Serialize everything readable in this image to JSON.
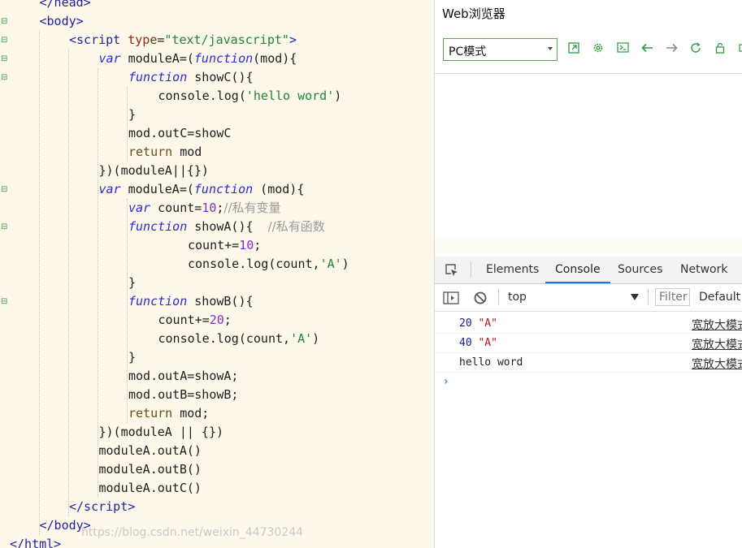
{
  "editor": {
    "lines": [
      {
        "indent": 1,
        "html": "<span class='tag'>&lt;/head&gt;</span>"
      },
      {
        "indent": 1,
        "html": "<span class='tag'>&lt;body&gt;</span>"
      },
      {
        "indent": 2,
        "html": "<span class='tag'>&lt;script</span> <span class='attr'>type</span>=<span class='str'>\"text/javascript\"</span><span class='tag'>&gt;</span>"
      },
      {
        "indent": 3,
        "html": "<span class='kw'>var</span> moduleA=(<span class='kw'>function</span>(mod){"
      },
      {
        "indent": 4,
        "html": "<span class='kw'>function</span> showC(){"
      },
      {
        "indent": 5,
        "html": "console.log(<span class='str'>'hello word'</span>)"
      },
      {
        "indent": 4,
        "html": "}"
      },
      {
        "indent": 4,
        "html": "mod.outC=showC"
      },
      {
        "indent": 4,
        "html": "<span class='plain-kw'>return</span> mod"
      },
      {
        "indent": 3,
        "html": "})(moduleA||{})"
      },
      {
        "indent": 3,
        "html": "<span class='kw'>var</span> moduleA=(<span class='kw'>function</span> (mod){"
      },
      {
        "indent": 4,
        "html": "<span class='kw'>var</span> count=<span class='num'>10</span>;<span class='cmt'>//私有变量</span>"
      },
      {
        "indent": 4,
        "html": "<span class='kw'>function</span> showA(){  <span class='cmt'>//私有函数</span>"
      },
      {
        "indent": 6,
        "html": "count+=<span class='num'>10</span>;"
      },
      {
        "indent": 6,
        "html": "console.log(count,<span class='str'>'A'</span>)"
      },
      {
        "indent": 4,
        "html": "}"
      },
      {
        "indent": 4,
        "html": "<span class='kw'>function</span> showB(){"
      },
      {
        "indent": 5,
        "html": "count+=<span class='num'>20</span>;"
      },
      {
        "indent": 5,
        "html": "console.log(count,<span class='str'>'A'</span>)"
      },
      {
        "indent": 4,
        "html": "}"
      },
      {
        "indent": 4,
        "html": "mod.outA=showA;"
      },
      {
        "indent": 4,
        "html": "mod.outB=showB;"
      },
      {
        "indent": 4,
        "html": "<span class='plain-kw'>return</span> mod;"
      },
      {
        "indent": 3,
        "html": "})(moduleA || {})"
      },
      {
        "indent": 3,
        "html": "moduleA.outA()"
      },
      {
        "indent": 3,
        "html": "moduleA.outB()"
      },
      {
        "indent": 3,
        "html": "moduleA.outC()"
      },
      {
        "indent": 2,
        "html": "<span class='tag'>&lt;/script&gt;</span>"
      },
      {
        "indent": 1,
        "html": "<span class='tag'>&lt;/body&gt;</span>"
      },
      {
        "indent": 0,
        "html": "<span class='tag'>&lt;/html&gt;</span>"
      }
    ],
    "fold_lines": [
      1,
      2,
      3,
      4,
      10,
      12,
      16
    ]
  },
  "browser": {
    "title": "Web浏览器",
    "mode_select": "PC模式",
    "toolbar_icons": [
      "open-external-icon",
      "settings-gear-icon",
      "terminal-icon",
      "back-arrow-icon",
      "forward-arrow-icon",
      "refresh-icon",
      "lock-icon",
      "more-icon"
    ]
  },
  "devtools": {
    "tabs": [
      "Elements",
      "Console",
      "Sources",
      "Network"
    ],
    "active_tab": "Console",
    "context": "top",
    "filter_placeholder": "Filter",
    "levels": "Default l",
    "messages": [
      {
        "num": "20",
        "str": "\"A\"",
        "text": "",
        "source": "宽放大模式"
      },
      {
        "num": "40",
        "str": "\"A\"",
        "text": "",
        "source": "宽放大模式"
      },
      {
        "num": "",
        "str": "",
        "text": "hello word",
        "source": "宽放大模式"
      }
    ],
    "prompt": "›"
  },
  "watermark": "https://blog.csdn.net/weixin_44730244",
  "colors": {
    "editor_bg": "#fdf8e9",
    "accent_green": "#2e9a44",
    "devtools_blue": "#1a73e8"
  }
}
